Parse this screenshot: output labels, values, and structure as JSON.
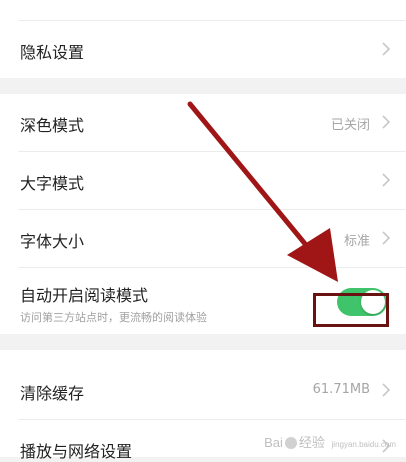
{
  "settings": {
    "privacy": {
      "label": "隐私设置"
    },
    "dark_mode": {
      "label": "深色模式",
      "value": "已关闭"
    },
    "large_text": {
      "label": "大字模式"
    },
    "font_size": {
      "label": "字体大小",
      "value": "标准"
    },
    "reader_mode": {
      "label": "自动开启阅读模式",
      "subtitle": "访问第三方站点时，更流畅的阅读体验",
      "enabled": true
    },
    "clear_cache": {
      "label": "清除缓存",
      "value": "61.71MB"
    },
    "playback_network": {
      "label": "播放与网络设置"
    }
  },
  "colors": {
    "toggle_on": "#3fc46b",
    "annotation_arrow": "#a01515",
    "annotation_box": "#6a1111"
  },
  "watermark": {
    "brand": "Bai",
    "brand2": "经验",
    "sub": "jingyan.baidu.com"
  }
}
